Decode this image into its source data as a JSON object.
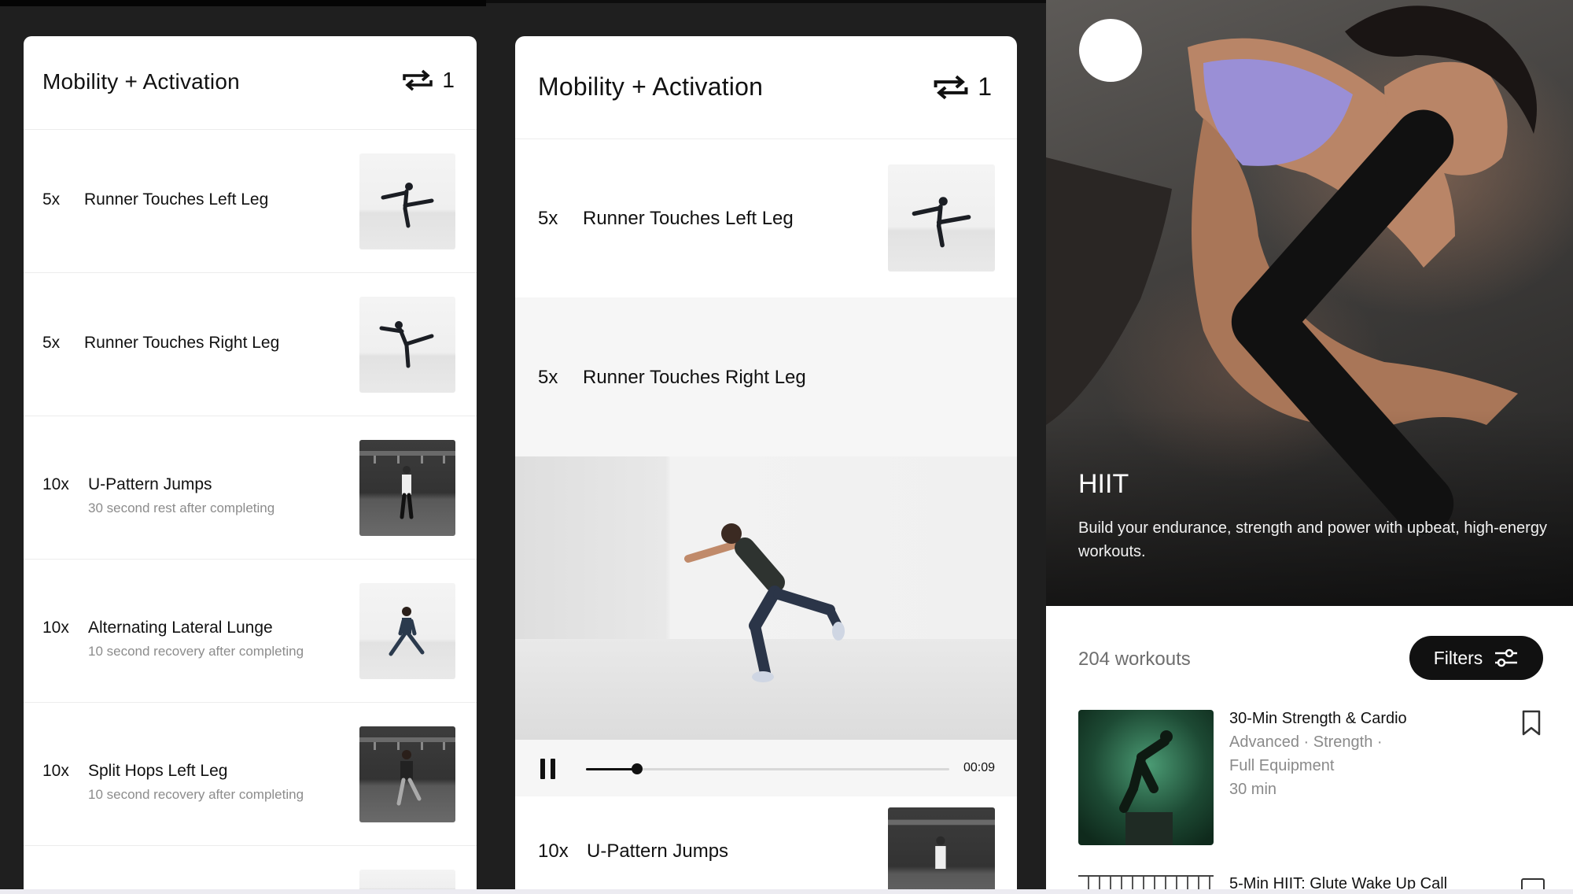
{
  "left_panel": {
    "title": "Mobility + Activation",
    "repeat_count": "1",
    "rows": [
      {
        "reps": "5x",
        "name": "Runner Touches Left Leg",
        "sub": ""
      },
      {
        "reps": "5x",
        "name": "Runner Touches Right Leg",
        "sub": ""
      },
      {
        "reps": "10x",
        "name": "U-Pattern Jumps",
        "sub": "30 second rest after completing"
      },
      {
        "reps": "10x",
        "name": "Alternating Lateral Lunge",
        "sub": "10 second recovery after completing"
      },
      {
        "reps": "10x",
        "name": "Split Hops Left Leg",
        "sub": "10 second recovery after completing"
      }
    ]
  },
  "middle_panel": {
    "title": "Mobility + Activation",
    "repeat_count": "1",
    "rows": [
      {
        "reps": "5x",
        "name": "Runner Touches Left Leg"
      },
      {
        "reps": "5x",
        "name": "Runner Touches Right Leg"
      },
      {
        "reps": "10x",
        "name": "U-Pattern Jumps"
      }
    ],
    "player": {
      "time": "00:09",
      "progress": 0.14
    }
  },
  "right_panel": {
    "hero_title": "HIIT",
    "hero_description": "Build your endurance, strength and power with upbeat, high-energy workouts.",
    "workout_count": "204 workouts",
    "filters_label": "Filters",
    "workouts": [
      {
        "title": "30-Min Strength & Cardio",
        "meta1": "Advanced · Strength ·",
        "meta2": "Full Equipment",
        "meta3": "30 min"
      },
      {
        "title": "5-Min HIIT: Glute Wake Up Call"
      }
    ]
  },
  "icons": [
    "repeat-icon",
    "pause-icon",
    "back-chevron-icon",
    "filter-sliders-icon",
    "bookmark-icon"
  ],
  "colors": {
    "dark_bg": "#1f1f1f",
    "button_black": "#111111",
    "muted_text": "#8c8c8c"
  }
}
